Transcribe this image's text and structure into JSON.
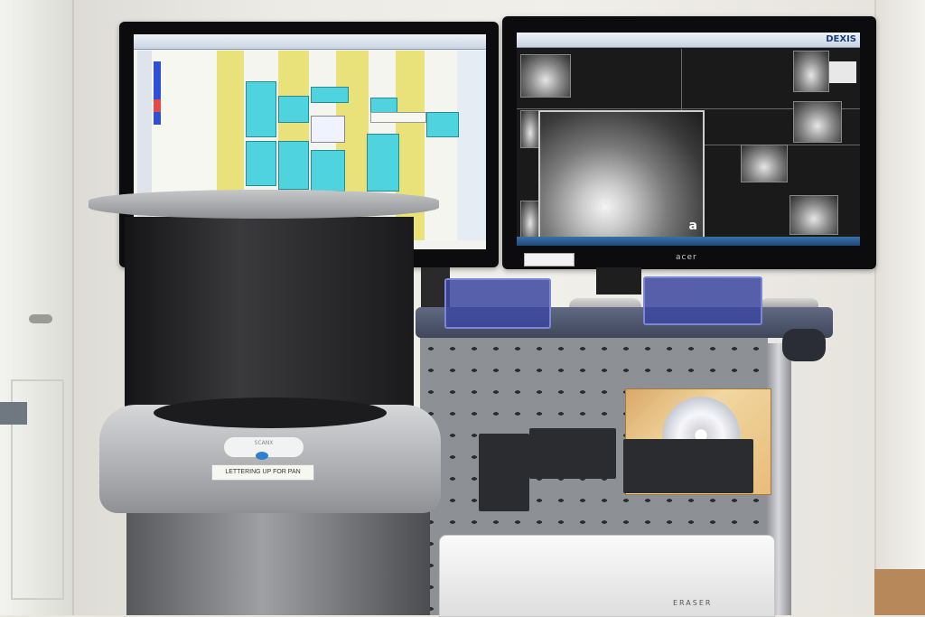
{
  "scene": {
    "left_monitor": {
      "app": "dental-scheduling-software"
    },
    "right_monitor": {
      "app_logo": "DEXIS",
      "brand": "acer",
      "xray_panel_label": "a"
    },
    "scanner": {
      "brand_label": "SCANX",
      "tag_text": "LETTERING UP FOR PAN"
    },
    "printer": {
      "brand_label": "ERASER"
    },
    "colors": {
      "schedule_yellow": "#e9e17a",
      "schedule_cyan": "#4fd3df",
      "tray_blue": "#3c46a0",
      "scanner_grey": "#a5a7aa"
    }
  }
}
